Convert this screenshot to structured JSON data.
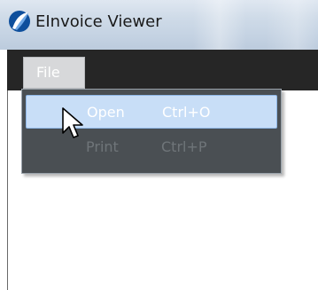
{
  "window": {
    "title": "EInvoice Viewer",
    "app_icon": "app-logo-icon"
  },
  "menubar": {
    "items": [
      {
        "label": "File",
        "state": "open"
      }
    ]
  },
  "dropdown": {
    "items": [
      {
        "label": "Open",
        "shortcut": "Ctrl+O",
        "state": "highlighted"
      },
      {
        "label": "Print",
        "shortcut": "Ctrl+P",
        "state": "disabled"
      }
    ]
  },
  "cursor": {
    "icon": "mouse-pointer-icon"
  },
  "colors": {
    "menubar_bg": "#262626",
    "dropdown_bg": "#4a4f53",
    "highlight_bg": "#c8def7",
    "highlight_border": "#8fb8e8",
    "disabled_text": "#6f7579",
    "titlebar": "#c5d3e3"
  }
}
